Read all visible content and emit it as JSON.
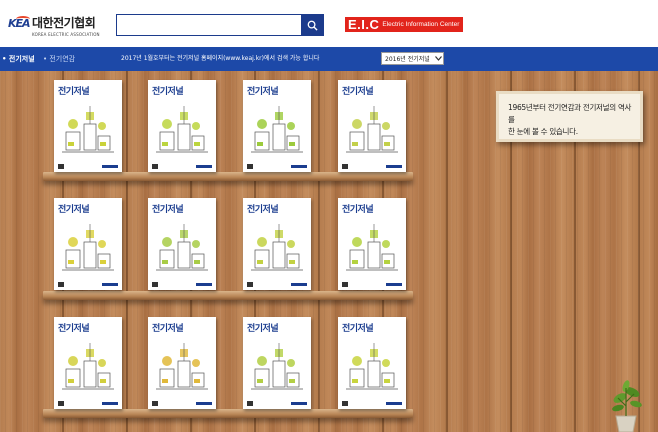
{
  "header": {
    "logo_korean": "대한전기협회",
    "logo_english": "KOREA ELECTRIC ASSOCIATION",
    "logo_mark": "KEA",
    "search": {
      "value": "",
      "placeholder": ""
    },
    "eic_logo": {
      "big": "E.I.C",
      "small": "Electric Information Center"
    }
  },
  "nav": {
    "items": [
      {
        "label": "• 전기저널",
        "active": true
      },
      {
        "label": "• 전기연감",
        "active": false
      }
    ],
    "notice": "2017년 1월호부터는 전기저널 홈페이지(www.keaj.kr)에서 검색 가능 합니다",
    "year_select": {
      "selected": "2016년 전기저널"
    }
  },
  "shelf": {
    "note_line1": "1965년부터 전기연감과 전기저널의 역사를",
    "note_line2": "한 눈에 볼 수 있습니다.",
    "magazines": [
      {
        "title": "전기저널",
        "accent": "#c9d23a"
      },
      {
        "title": "전기저널",
        "accent": "#bcd53e"
      },
      {
        "title": "전기저널",
        "accent": "#9ccb3c"
      },
      {
        "title": "전기저널",
        "accent": "#c3d04a"
      },
      {
        "title": "전기저널",
        "accent": "#dad03b"
      },
      {
        "title": "전기저널",
        "accent": "#a8cc46"
      },
      {
        "title": "전기저널",
        "accent": "#c2d142"
      },
      {
        "title": "전기저널",
        "accent": "#b4d23f"
      },
      {
        "title": "전기저널",
        "accent": "#d1cf3c"
      },
      {
        "title": "전기저널",
        "accent": "#e0b83a"
      },
      {
        "title": "전기저널",
        "accent": "#b3cf44"
      },
      {
        "title": "전기저널",
        "accent": "#c8d43d"
      }
    ]
  },
  "colors": {
    "brand_blue": "#1d49a8",
    "eic_red": "#e2241b"
  }
}
